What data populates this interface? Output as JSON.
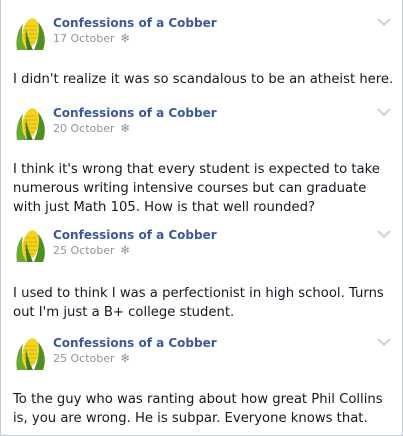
{
  "posts": [
    {
      "author": "Confessions of a Cobber",
      "date": "17 October",
      "text": "I didn't realize it was so scandalous to be an atheist here."
    },
    {
      "author": "Confessions of a Cobber",
      "date": "20 October",
      "text": "I think it's wrong that every student is expected to take numerous writing intensive courses but can graduate with just Math 105. How is that well rounded?"
    },
    {
      "author": "Confessions of a Cobber",
      "date": "25 October",
      "text": "I used to think I was a perfectionist in high school. Turns out I'm just a B+ college student."
    },
    {
      "author": "Confessions of a Cobber",
      "date": "25 October",
      "text": "To the guy who was ranting about how great Phil Collins is, you are wrong. He is subpar. Everyone knows that."
    }
  ],
  "icons": {
    "avatar": "corn-cob-avatar",
    "privacy": "gear-icon",
    "menu": "chevron-down-icon"
  },
  "colors": {
    "author_link": "#3b5998",
    "meta_text": "#90949c",
    "body_text": "#141823"
  }
}
